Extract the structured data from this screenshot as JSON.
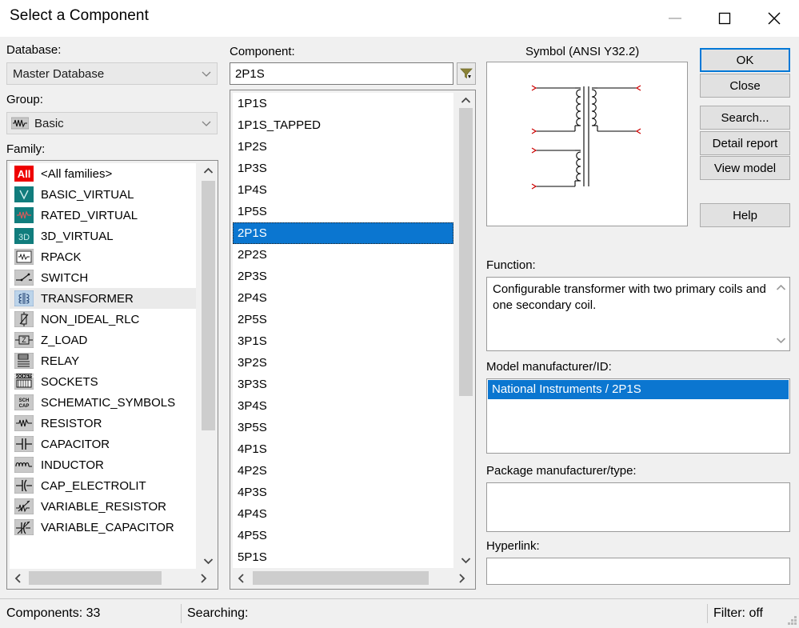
{
  "window": {
    "title": "Select a Component",
    "minimize_label": "minimize",
    "maximize_label": "maximize",
    "close_label": "close"
  },
  "left": {
    "database_label": "Database:",
    "database_value": "Master Database",
    "group_label": "Group:",
    "group_value": "Basic",
    "family_label": "Family:",
    "families": [
      {
        "label": "<All families>",
        "icon": "all-families-icon",
        "selected": false
      },
      {
        "label": "BASIC_VIRTUAL",
        "icon": "basic-virtual-icon",
        "selected": false
      },
      {
        "label": "RATED_VIRTUAL",
        "icon": "rated-virtual-icon",
        "selected": false
      },
      {
        "label": "3D_VIRTUAL",
        "icon": "3d-virtual-icon",
        "selected": false
      },
      {
        "label": "RPACK",
        "icon": "rpack-icon",
        "selected": false
      },
      {
        "label": "SWITCH",
        "icon": "switch-icon",
        "selected": false
      },
      {
        "label": "TRANSFORMER",
        "icon": "transformer-icon",
        "selected": true
      },
      {
        "label": "NON_IDEAL_RLC",
        "icon": "non-ideal-rlc-icon",
        "selected": false
      },
      {
        "label": "Z_LOAD",
        "icon": "z-load-icon",
        "selected": false
      },
      {
        "label": "RELAY",
        "icon": "relay-icon",
        "selected": false
      },
      {
        "label": "SOCKETS",
        "icon": "sockets-icon",
        "selected": false
      },
      {
        "label": "SCHEMATIC_SYMBOLS",
        "icon": "schematic-symbols-icon",
        "selected": false
      },
      {
        "label": "RESISTOR",
        "icon": "resistor-icon",
        "selected": false
      },
      {
        "label": "CAPACITOR",
        "icon": "capacitor-icon",
        "selected": false
      },
      {
        "label": "INDUCTOR",
        "icon": "inductor-icon",
        "selected": false
      },
      {
        "label": "CAP_ELECTROLIT",
        "icon": "cap-electrolit-icon",
        "selected": false
      },
      {
        "label": "VARIABLE_RESISTOR",
        "icon": "variable-resistor-icon",
        "selected": false
      },
      {
        "label": "VARIABLE_CAPACITOR",
        "icon": "variable-capacitor-icon",
        "selected": false
      }
    ]
  },
  "middle": {
    "component_label": "Component:",
    "component_value": "2P1S",
    "filter_button_name": "filter-icon",
    "components": [
      {
        "label": "1P1S",
        "selected": false
      },
      {
        "label": "1P1S_TAPPED",
        "selected": false
      },
      {
        "label": "1P2S",
        "selected": false
      },
      {
        "label": "1P3S",
        "selected": false
      },
      {
        "label": "1P4S",
        "selected": false
      },
      {
        "label": "1P5S",
        "selected": false
      },
      {
        "label": "2P1S",
        "selected": true
      },
      {
        "label": "2P2S",
        "selected": false
      },
      {
        "label": "2P3S",
        "selected": false
      },
      {
        "label": "2P4S",
        "selected": false
      },
      {
        "label": "2P5S",
        "selected": false
      },
      {
        "label": "3P1S",
        "selected": false
      },
      {
        "label": "3P2S",
        "selected": false
      },
      {
        "label": "3P3S",
        "selected": false
      },
      {
        "label": "3P4S",
        "selected": false
      },
      {
        "label": "3P5S",
        "selected": false
      },
      {
        "label": "4P1S",
        "selected": false
      },
      {
        "label": "4P2S",
        "selected": false
      },
      {
        "label": "4P3S",
        "selected": false
      },
      {
        "label": "4P4S",
        "selected": false
      },
      {
        "label": "4P5S",
        "selected": false
      },
      {
        "label": "5P1S",
        "selected": false
      }
    ]
  },
  "right": {
    "symbol_label": "Symbol (ANSI Y32.2)",
    "function_label": "Function:",
    "function_text": "Configurable transformer with two primary coils and one secondary coil.",
    "model_label": "Model manufacturer/ID:",
    "model_value": "National Instruments / 2P1S",
    "package_label": "Package manufacturer/type:",
    "package_value": "",
    "hyperlink_label": "Hyperlink:",
    "hyperlink_value": ""
  },
  "buttons": {
    "ok": "OK",
    "close": "Close",
    "search": "Search...",
    "detail_report": "Detail report",
    "view_model": "View model",
    "help": "Help"
  },
  "statusbar": {
    "components": "Components: 33",
    "searching": "Searching:",
    "filter": "Filter: off"
  },
  "colors": {
    "selection_blue": "#0b76d0",
    "default_button_border": "#0078d7",
    "dialog_background": "#f0f0f0",
    "family_icon_teal": "#117d7d",
    "all_icon_red": "#ee0000"
  }
}
